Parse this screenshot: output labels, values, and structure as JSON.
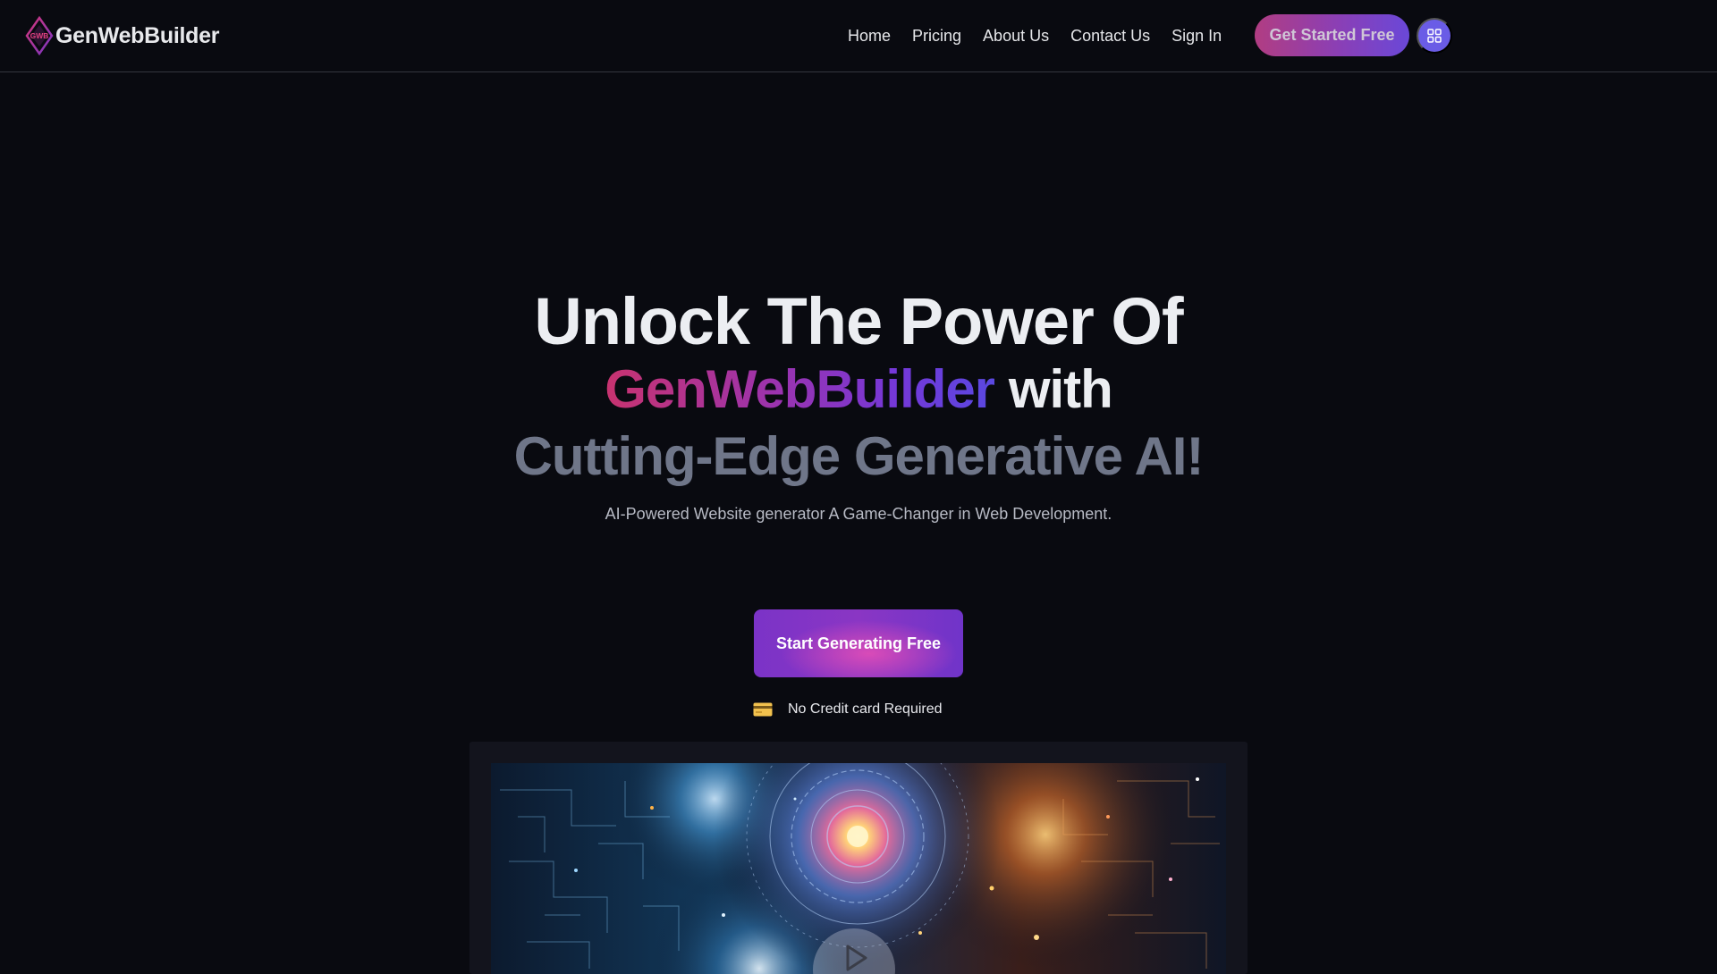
{
  "brand": {
    "name": "GenWebBuilder",
    "logo_text": "GWB"
  },
  "nav": {
    "links": [
      "Home",
      "Pricing",
      "About Us",
      "Contact Us",
      "Sign In"
    ],
    "cta_label": "Get Started Free",
    "menu_icon": "grid-icon"
  },
  "hero": {
    "title_line1": "Unlock The Power Of",
    "title_brand": "GenWebBuilder",
    "title_with": "with",
    "title_line3": "Cutting-Edge Generative AI!",
    "subtitle": "AI-Powered Website generator A Game-Changer in Web Development.",
    "cta_label": "Start Generating Free",
    "note_icon": "credit-card-icon",
    "note": "No Credit card Required"
  },
  "media": {
    "icon": "play-icon"
  },
  "colors": {
    "background": "#090a10",
    "accent_pink": "#c8336f",
    "accent_purple": "#7438d8",
    "menu_button": "#6a5ce6"
  }
}
